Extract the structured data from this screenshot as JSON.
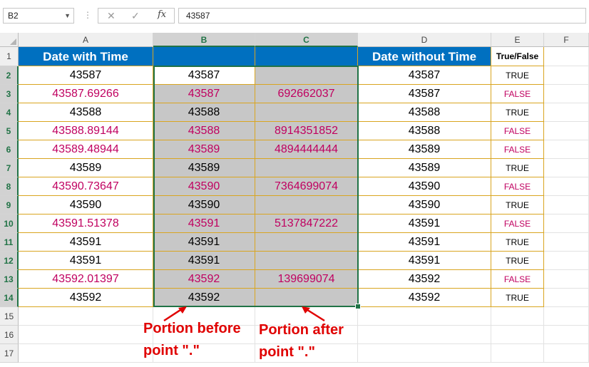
{
  "formula_bar": {
    "name_box": "B2",
    "formula": "43587",
    "icons": [
      "more-icon",
      "cancel-icon",
      "enter-icon",
      "fx-icon"
    ]
  },
  "columns": [
    "A",
    "B",
    "C",
    "D",
    "E",
    "F"
  ],
  "rows": [
    "1",
    "2",
    "3",
    "4",
    "5",
    "6",
    "7",
    "8",
    "9",
    "10",
    "11",
    "12",
    "13",
    "14",
    "15",
    "16",
    "17"
  ],
  "headers": {
    "a": "Date with Time",
    "b": "",
    "c": "",
    "d": "Date without Time",
    "e": "True/False"
  },
  "data_rows": [
    {
      "a": "43587",
      "b": "43587",
      "c": "",
      "d": "43587",
      "e": "TRUE"
    },
    {
      "a": "43587.69266",
      "b": "43587",
      "c": "692662037",
      "d": "43587",
      "e": "FALSE"
    },
    {
      "a": "43588",
      "b": "43588",
      "c": "",
      "d": "43588",
      "e": "TRUE"
    },
    {
      "a": "43588.89144",
      "b": "43588",
      "c": "8914351852",
      "d": "43588",
      "e": "FALSE"
    },
    {
      "a": "43589.48944",
      "b": "43589",
      "c": "4894444444",
      "d": "43589",
      "e": "FALSE"
    },
    {
      "a": "43589",
      "b": "43589",
      "c": "",
      "d": "43589",
      "e": "TRUE"
    },
    {
      "a": "43590.73647",
      "b": "43590",
      "c": "7364699074",
      "d": "43590",
      "e": "FALSE"
    },
    {
      "a": "43590",
      "b": "43590",
      "c": "",
      "d": "43590",
      "e": "TRUE"
    },
    {
      "a": "43591.51378",
      "b": "43591",
      "c": "5137847222",
      "d": "43591",
      "e": "FALSE"
    },
    {
      "a": "43591",
      "b": "43591",
      "c": "",
      "d": "43591",
      "e": "TRUE"
    },
    {
      "a": "43591",
      "b": "43591",
      "c": "",
      "d": "43591",
      "e": "TRUE"
    },
    {
      "a": "43592.01397",
      "b": "43592",
      "c": "139699074",
      "d": "43592",
      "e": "FALSE"
    },
    {
      "a": "43592",
      "b": "43592",
      "c": "",
      "d": "43592",
      "e": "TRUE"
    }
  ],
  "annotations": {
    "before": "Portion before\npoint \".\"",
    "after": "Portion after\npoint \".\""
  },
  "colors": {
    "header_fill": "#0070c0",
    "false_text": "#c00060",
    "selection": "#217346",
    "annotation": "#e00000"
  }
}
